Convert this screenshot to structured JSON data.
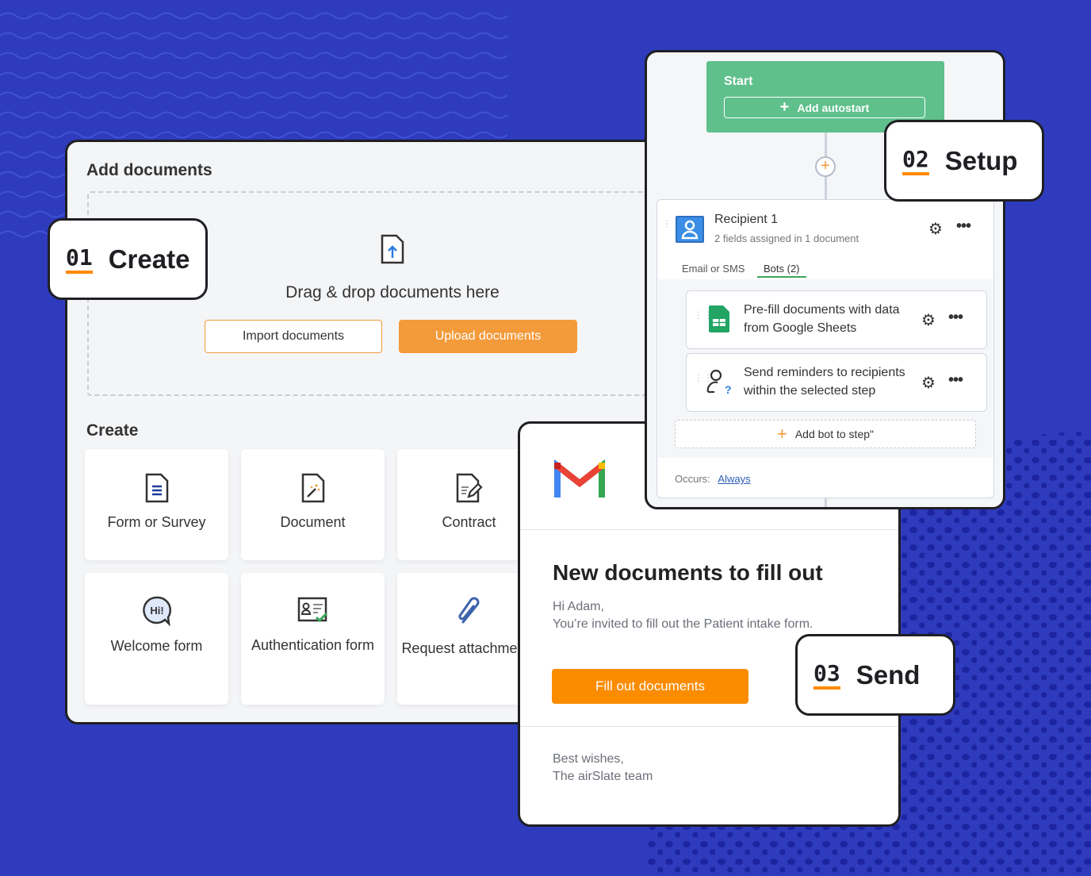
{
  "colors": {
    "background": "#2e3bbd",
    "accent": "#f39a3a",
    "orange_cta": "#fb8c00",
    "green": "#5fc08c",
    "link": "#2d5db5"
  },
  "add_documents": {
    "title": "Add documents",
    "drop_text": "Drag & drop documents here",
    "import_label": "Import documents",
    "upload_label": "Upload documents",
    "create_title": "Create",
    "tiles": [
      {
        "label": "Form or Survey",
        "icon": "form-list-icon"
      },
      {
        "label": "Document",
        "icon": "magic-document-icon"
      },
      {
        "label": "Contract",
        "icon": "contract-pen-icon"
      },
      {
        "label": "Welcome form",
        "icon": "hi-bubble-icon"
      },
      {
        "label": "Authentication form",
        "icon": "id-card-check-icon"
      },
      {
        "label": "Request attachments",
        "icon": "paperclip-icon"
      }
    ]
  },
  "badges": [
    {
      "num": "01",
      "label": "Create"
    },
    {
      "num": "02",
      "label": "Setup"
    },
    {
      "num": "03",
      "label": "Send"
    }
  ],
  "setup": {
    "start_label": "Start",
    "add_autostart": "Add autostart",
    "recipient_name": "Recipient 1",
    "recipient_sub": "2 fields assigned in 1 document",
    "tabs": [
      "Email or SMS",
      "Bots (2)"
    ],
    "bots": [
      {
        "text": "Pre-fill documents with data from Google Sheets",
        "icon": "google-sheets-icon"
      },
      {
        "text": "Send reminders to recipients within the selected step",
        "icon": "user-question-icon"
      }
    ],
    "add_bot": "Add bot to step\"",
    "occurs_label": "Occurs:",
    "occurs_value": "Always"
  },
  "email": {
    "title": "New documents to fill out",
    "greeting": "Hi Adam,",
    "body": "You’re invited to fill out the Patient intake form.",
    "cta": "Fill out documents",
    "signoff": "Best wishes,",
    "team": "The airSlate team"
  }
}
